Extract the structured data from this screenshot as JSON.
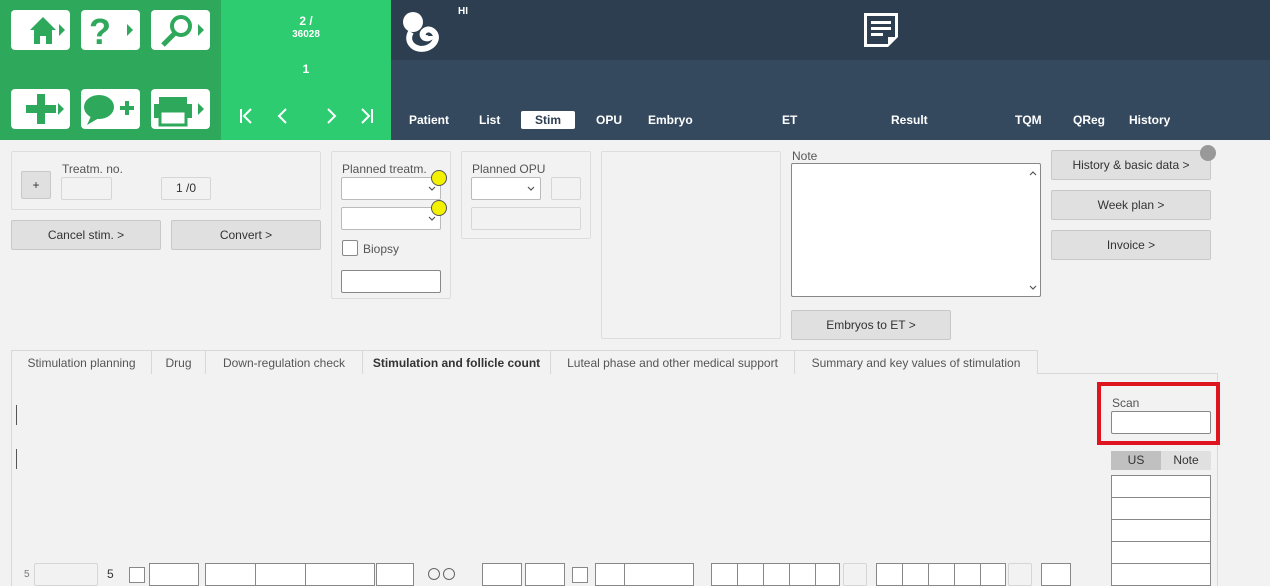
{
  "header": {
    "counter_top": "2 /",
    "counter_total": "36028",
    "counter_sub": "1",
    "patient_initials": "HI"
  },
  "nav": {
    "tabs": [
      {
        "label": "Patient"
      },
      {
        "label": "List"
      },
      {
        "label": "Stim"
      },
      {
        "label": "OPU"
      },
      {
        "label": "Embryo"
      },
      {
        "label": "ET"
      },
      {
        "label": "Result"
      },
      {
        "label": "TQM"
      },
      {
        "label": "QReg"
      },
      {
        "label": "History"
      }
    ],
    "active": "Stim"
  },
  "treatment": {
    "plus_label": "+",
    "treatm_no_label": "Treatm. no.",
    "treatm_no_value": "",
    "count_value": "1 /0",
    "cancel_label": "Cancel stim. >",
    "convert_label": "Convert >"
  },
  "planned": {
    "label": "Planned treatm.",
    "biopsy_label": "Biopsy",
    "opu_label": "Planned OPU"
  },
  "note": {
    "label": "Note",
    "embryos_button": "Embryos to ET >"
  },
  "side_buttons": {
    "history": "History & basic data >",
    "week_plan": "Week plan >",
    "invoice": "Invoice >"
  },
  "subtabs": [
    {
      "label": "Stimulation planning"
    },
    {
      "label": "Drug"
    },
    {
      "label": "Down-regulation check"
    },
    {
      "label": "Stimulation and follicle count"
    },
    {
      "label": "Luteal phase and other medical support"
    },
    {
      "label": "Summary and key values of stimulation"
    }
  ],
  "scan": {
    "label": "Scan",
    "value": "",
    "toggle_us": "US",
    "toggle_note": "Note"
  },
  "bottom_row": {
    "num1": "5",
    "num2": "5"
  },
  "colors": {
    "green_dark": "#2ea85a",
    "green_light": "#2ecc71",
    "navy": "#2c3e50",
    "highlight_red": "#e0141e",
    "indicator_yellow": "#f3f000"
  }
}
